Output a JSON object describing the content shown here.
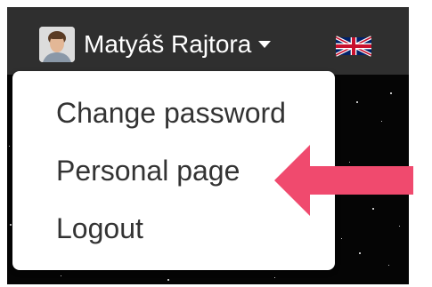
{
  "navbar": {
    "user": {
      "name": "Matyáš Rajtora",
      "avatar_icon": "user-avatar",
      "dropdown_icon": "caret-down-icon"
    },
    "language_icon": "uk-flag-icon"
  },
  "dropdown": {
    "items": [
      {
        "label": "Change password"
      },
      {
        "label": "Personal page"
      },
      {
        "label": "Logout"
      }
    ]
  },
  "annotation": {
    "icon": "arrow-left-icon",
    "color": "#f04a6e"
  },
  "colors": {
    "navbar": "#2f2f2f",
    "background": "#050505",
    "menu_text": "#333333"
  }
}
